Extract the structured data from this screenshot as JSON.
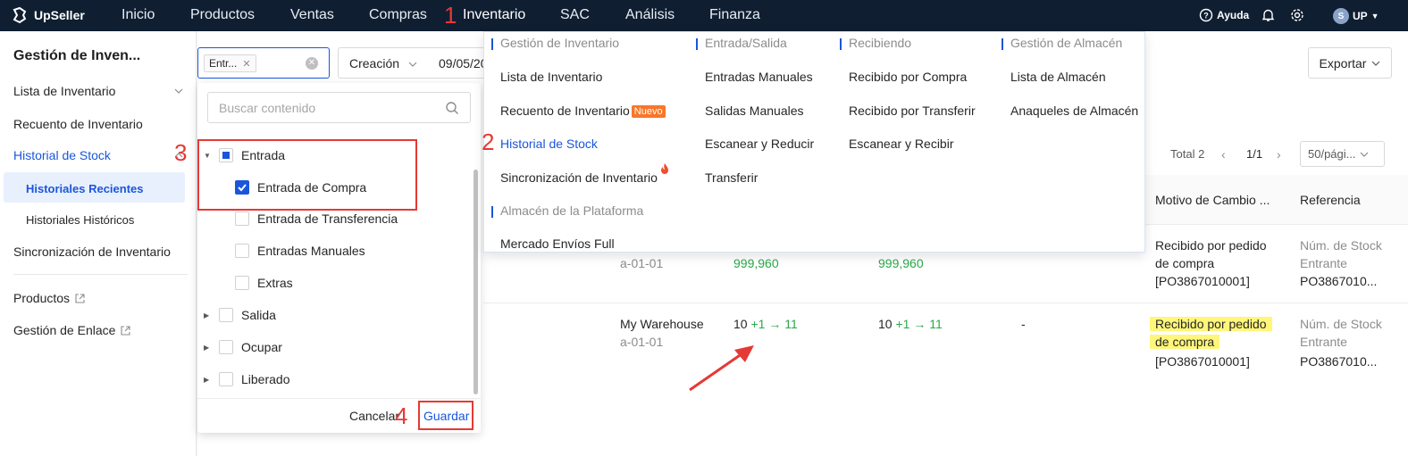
{
  "nav": {
    "brand": "UpSeller",
    "items": [
      "Inicio",
      "Productos",
      "Ventas",
      "Compras",
      "Inventario",
      "SAC",
      "Análisis",
      "Finanza"
    ],
    "help": "Ayuda",
    "user": "UP",
    "user_badge": "S"
  },
  "sidebar": {
    "title": "Gestión de Inven...",
    "items": {
      "lista": "Lista de Inventario",
      "recuento": "Recuento de Inventario",
      "historial": "Historial de Stock",
      "recientes": "Historiales Recientes",
      "historicos": "Historiales Históricos",
      "sincronizacion": "Sincronización de Inventario",
      "productos": "Productos",
      "enlace": "Gestión de Enlace"
    }
  },
  "filters": {
    "tag": "Entr...",
    "select": "Creación",
    "date": "09/05/20"
  },
  "export_label": "Exportar",
  "pager": {
    "total": "Total 2",
    "page": "1/1",
    "page_size": "50/pági..."
  },
  "table": {
    "headers": {
      "motivo": "Motivo de Cambio ...",
      "referencia": "Referencia"
    },
    "row1": {
      "warehouse_loc": "a-01-01",
      "v1": "999,960",
      "v2": "999,960",
      "motivo_l1": "Recibido por pedido",
      "motivo_l2": "de compra",
      "motivo_l3": "[PO3867010001]",
      "ref_l1": "Núm. de Stock",
      "ref_l2": "Entrante",
      "ref_l3": "PO3867010..."
    },
    "row2": {
      "warehouse": "My Warehouse",
      "warehouse_loc": "a-01-01",
      "v1_base": "10",
      "v1_delta": "+1 → 11",
      "v2_base": "10",
      "v2_delta": "+1 → 11",
      "dash": "-",
      "motivo_l1": "Recibido por pedido",
      "motivo_l2": "de compra",
      "motivo_l3": "[PO3867010001]",
      "ref_l1": "Núm. de Stock",
      "ref_l2": "Entrante",
      "ref_l3": "PO3867010..."
    }
  },
  "dropdown": {
    "search_placeholder": "Buscar contenido",
    "tree": {
      "entrada": "Entrada",
      "entrada_compra": "Entrada de Compra",
      "entrada_transferencia": "Entrada de Transferencia",
      "entradas_manuales": "Entradas Manuales",
      "extras": "Extras",
      "salida": "Salida",
      "ocupar": "Ocupar",
      "liberado": "Liberado"
    },
    "cancel": "Cancelar",
    "save": "Guardar"
  },
  "mega_menu": {
    "col1": {
      "header": "Gestión de Inventario",
      "items": [
        "Lista de Inventario",
        "Recuento de Inventario",
        "Historial de Stock",
        "Sincronización de Inventario"
      ],
      "new_badge": "Nuevo",
      "header2": "Almacén de la Plataforma",
      "items2": [
        "Mercado Envíos Full"
      ]
    },
    "col2": {
      "header": "Entrada/Salida",
      "items": [
        "Entradas Manuales",
        "Salidas Manuales",
        "Escanear y Reducir",
        "Transferir"
      ]
    },
    "col3": {
      "header": "Recibiendo",
      "items": [
        "Recibido por Compra",
        "Recibido por Transferir",
        "Escanear y Recibir"
      ]
    },
    "col4": {
      "header": "Gestión de Almacén",
      "items": [
        "Lista de Almacén",
        "Anaqueles de Almacén"
      ]
    }
  },
  "annotations": [
    "1",
    "2",
    "3",
    "4"
  ],
  "colors": {
    "nav_bg": "#0f1e31",
    "accent": "#1a56db",
    "annotation": "#e53935",
    "highlight": "#fff67a",
    "positive": "#2aa948"
  }
}
